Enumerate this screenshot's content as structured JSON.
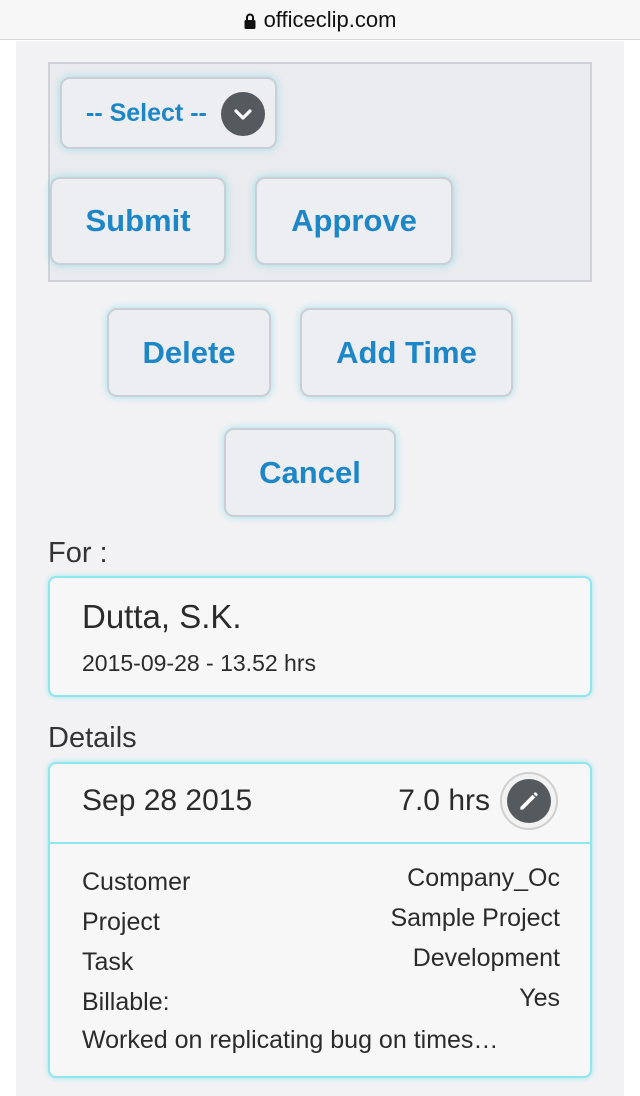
{
  "browser": {
    "url": "officeclip.com"
  },
  "actions": {
    "select_label": "-- Select --",
    "submit": "Submit",
    "approve": "Approve",
    "delete": "Delete",
    "add_time": "Add Time",
    "cancel": "Cancel"
  },
  "for": {
    "label": "For :",
    "name": "Dutta, S.K.",
    "summary": "2015-09-28 - 13.52 hrs"
  },
  "details": {
    "label": "Details",
    "date": "Sep 28 2015",
    "hours": "7.0 hrs",
    "rows": [
      {
        "key": "Customer",
        "value": "Company_Oc"
      },
      {
        "key": "Project",
        "value": "Sample Project"
      },
      {
        "key": "Task",
        "value": "Development"
      },
      {
        "key": "Billable:",
        "value": "Yes"
      }
    ],
    "note": "Worked on replicating bug on times…"
  },
  "colors": {
    "accent": "#1d86c6",
    "card_border": "#8ee6ef"
  }
}
